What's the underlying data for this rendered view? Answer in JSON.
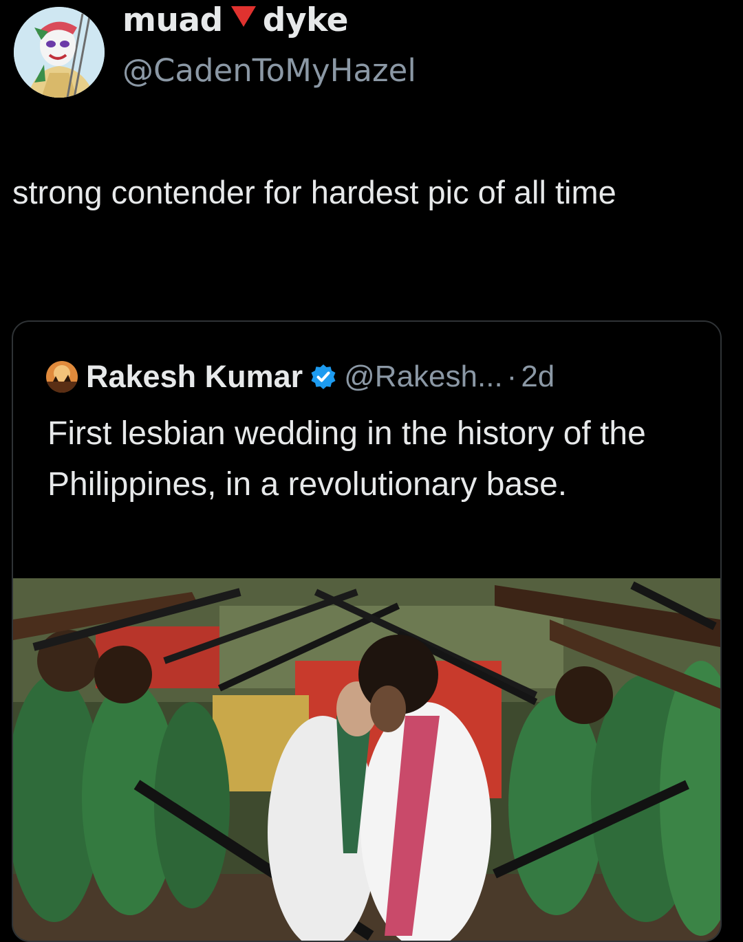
{
  "tweet": {
    "author": {
      "name_part1": "muad",
      "name_emoji": "red-down-triangle",
      "name_part2": "dyke",
      "handle": "@CadenToMyHazel"
    },
    "text": "strong contender for hardest pic of all time"
  },
  "quoted_tweet": {
    "author_name": "Rakesh Kumar",
    "verified": true,
    "handle": "@Rakesh...",
    "separator": "·",
    "time": "2d",
    "text": "First lesbian wedding in the history of the Philippines, in a revolutionary base.",
    "media": {
      "type": "photo"
    }
  },
  "colors": {
    "background": "#000000",
    "primary_text": "#e7e9ea",
    "secondary_text": "#8b98a5",
    "card_border": "#2f3336",
    "verified_badge": "#1d9bf0",
    "name_emoji": "#e0322f"
  }
}
